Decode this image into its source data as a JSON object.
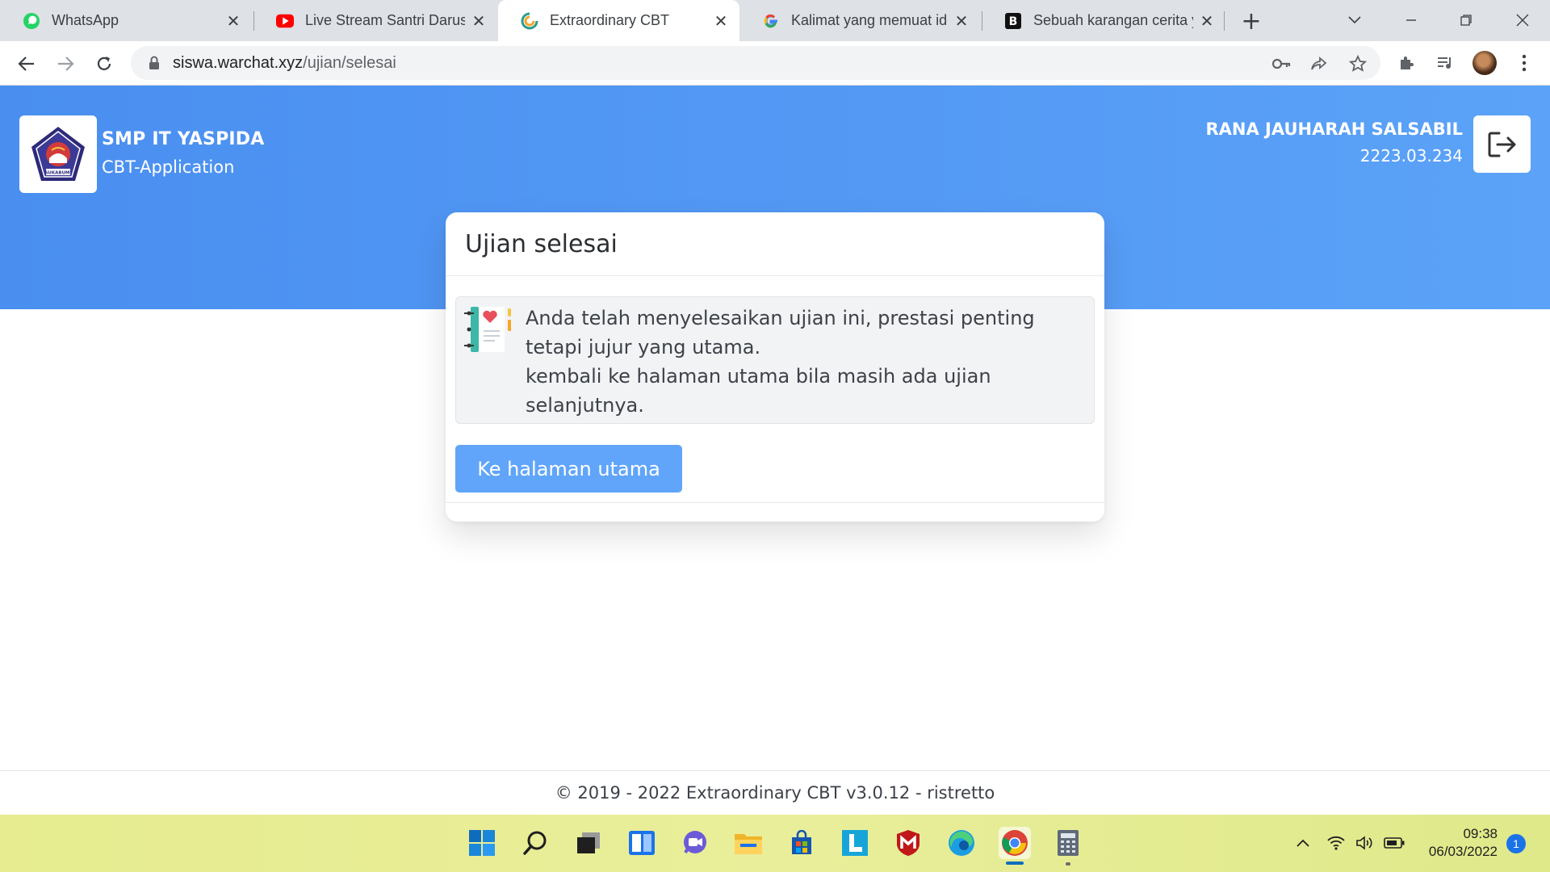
{
  "browser": {
    "tabs": [
      {
        "title": "WhatsApp",
        "icon": "whatsapp-icon",
        "active": false
      },
      {
        "title": "Live Stream Santri Darussy",
        "icon": "youtube-icon",
        "active": false
      },
      {
        "title": "Extraordinary CBT",
        "icon": "cbt-icon",
        "active": true
      },
      {
        "title": "Kalimat yang memuat ide",
        "icon": "google-icon",
        "active": false
      },
      {
        "title": "Sebuah karangan cerita y",
        "icon": "brainly-icon",
        "active": false
      }
    ],
    "url_host": "siswa.warchat.xyz",
    "url_path": "/ujian/selesai"
  },
  "header": {
    "school_name": "SMP IT YASPIDA",
    "app_name": "CBT-Application",
    "logo_text": "SUKABUMI",
    "user_name": "RANA JAUHARAH SALSABIL",
    "user_id": "2223.03.234"
  },
  "card": {
    "title": "Ujian selesai",
    "message_line1": "Anda telah menyelesaikan ujian ini, prestasi penting tetapi jujur yang utama.",
    "message_line2": "kembali ke halaman utama bila masih ada ujian selanjutnya.",
    "button_label": "Ke halaman utama"
  },
  "footer": {
    "text": "© 2019 - 2022 Extraordinary CBT v3.0.12 - ristretto"
  },
  "taskbar": {
    "time": "09:38",
    "date": "06/03/2022",
    "notification_count": "1"
  },
  "colors": {
    "hero": "#4a8ff0",
    "button": "#60a5fa",
    "brand_text": "#ffffff"
  }
}
